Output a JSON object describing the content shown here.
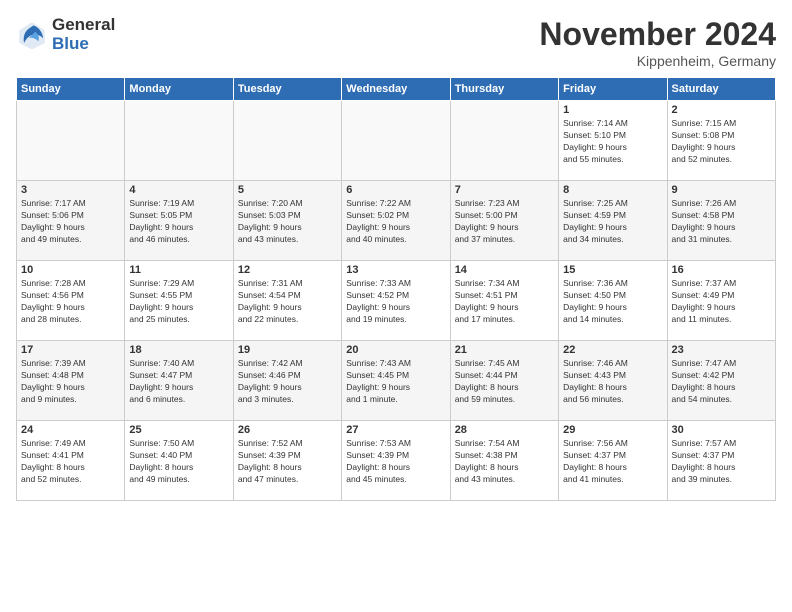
{
  "logo": {
    "general": "General",
    "blue": "Blue"
  },
  "title": "November 2024",
  "location": "Kippenheim, Germany",
  "headers": [
    "Sunday",
    "Monday",
    "Tuesday",
    "Wednesday",
    "Thursday",
    "Friday",
    "Saturday"
  ],
  "weeks": [
    [
      {
        "day": "",
        "info": ""
      },
      {
        "day": "",
        "info": ""
      },
      {
        "day": "",
        "info": ""
      },
      {
        "day": "",
        "info": ""
      },
      {
        "day": "",
        "info": ""
      },
      {
        "day": "1",
        "info": "Sunrise: 7:14 AM\nSunset: 5:10 PM\nDaylight: 9 hours\nand 55 minutes."
      },
      {
        "day": "2",
        "info": "Sunrise: 7:15 AM\nSunset: 5:08 PM\nDaylight: 9 hours\nand 52 minutes."
      }
    ],
    [
      {
        "day": "3",
        "info": "Sunrise: 7:17 AM\nSunset: 5:06 PM\nDaylight: 9 hours\nand 49 minutes."
      },
      {
        "day": "4",
        "info": "Sunrise: 7:19 AM\nSunset: 5:05 PM\nDaylight: 9 hours\nand 46 minutes."
      },
      {
        "day": "5",
        "info": "Sunrise: 7:20 AM\nSunset: 5:03 PM\nDaylight: 9 hours\nand 43 minutes."
      },
      {
        "day": "6",
        "info": "Sunrise: 7:22 AM\nSunset: 5:02 PM\nDaylight: 9 hours\nand 40 minutes."
      },
      {
        "day": "7",
        "info": "Sunrise: 7:23 AM\nSunset: 5:00 PM\nDaylight: 9 hours\nand 37 minutes."
      },
      {
        "day": "8",
        "info": "Sunrise: 7:25 AM\nSunset: 4:59 PM\nDaylight: 9 hours\nand 34 minutes."
      },
      {
        "day": "9",
        "info": "Sunrise: 7:26 AM\nSunset: 4:58 PM\nDaylight: 9 hours\nand 31 minutes."
      }
    ],
    [
      {
        "day": "10",
        "info": "Sunrise: 7:28 AM\nSunset: 4:56 PM\nDaylight: 9 hours\nand 28 minutes."
      },
      {
        "day": "11",
        "info": "Sunrise: 7:29 AM\nSunset: 4:55 PM\nDaylight: 9 hours\nand 25 minutes."
      },
      {
        "day": "12",
        "info": "Sunrise: 7:31 AM\nSunset: 4:54 PM\nDaylight: 9 hours\nand 22 minutes."
      },
      {
        "day": "13",
        "info": "Sunrise: 7:33 AM\nSunset: 4:52 PM\nDaylight: 9 hours\nand 19 minutes."
      },
      {
        "day": "14",
        "info": "Sunrise: 7:34 AM\nSunset: 4:51 PM\nDaylight: 9 hours\nand 17 minutes."
      },
      {
        "day": "15",
        "info": "Sunrise: 7:36 AM\nSunset: 4:50 PM\nDaylight: 9 hours\nand 14 minutes."
      },
      {
        "day": "16",
        "info": "Sunrise: 7:37 AM\nSunset: 4:49 PM\nDaylight: 9 hours\nand 11 minutes."
      }
    ],
    [
      {
        "day": "17",
        "info": "Sunrise: 7:39 AM\nSunset: 4:48 PM\nDaylight: 9 hours\nand 9 minutes."
      },
      {
        "day": "18",
        "info": "Sunrise: 7:40 AM\nSunset: 4:47 PM\nDaylight: 9 hours\nand 6 minutes."
      },
      {
        "day": "19",
        "info": "Sunrise: 7:42 AM\nSunset: 4:46 PM\nDaylight: 9 hours\nand 3 minutes."
      },
      {
        "day": "20",
        "info": "Sunrise: 7:43 AM\nSunset: 4:45 PM\nDaylight: 9 hours\nand 1 minute."
      },
      {
        "day": "21",
        "info": "Sunrise: 7:45 AM\nSunset: 4:44 PM\nDaylight: 8 hours\nand 59 minutes."
      },
      {
        "day": "22",
        "info": "Sunrise: 7:46 AM\nSunset: 4:43 PM\nDaylight: 8 hours\nand 56 minutes."
      },
      {
        "day": "23",
        "info": "Sunrise: 7:47 AM\nSunset: 4:42 PM\nDaylight: 8 hours\nand 54 minutes."
      }
    ],
    [
      {
        "day": "24",
        "info": "Sunrise: 7:49 AM\nSunset: 4:41 PM\nDaylight: 8 hours\nand 52 minutes."
      },
      {
        "day": "25",
        "info": "Sunrise: 7:50 AM\nSunset: 4:40 PM\nDaylight: 8 hours\nand 49 minutes."
      },
      {
        "day": "26",
        "info": "Sunrise: 7:52 AM\nSunset: 4:39 PM\nDaylight: 8 hours\nand 47 minutes."
      },
      {
        "day": "27",
        "info": "Sunrise: 7:53 AM\nSunset: 4:39 PM\nDaylight: 8 hours\nand 45 minutes."
      },
      {
        "day": "28",
        "info": "Sunrise: 7:54 AM\nSunset: 4:38 PM\nDaylight: 8 hours\nand 43 minutes."
      },
      {
        "day": "29",
        "info": "Sunrise: 7:56 AM\nSunset: 4:37 PM\nDaylight: 8 hours\nand 41 minutes."
      },
      {
        "day": "30",
        "info": "Sunrise: 7:57 AM\nSunset: 4:37 PM\nDaylight: 8 hours\nand 39 minutes."
      }
    ]
  ]
}
